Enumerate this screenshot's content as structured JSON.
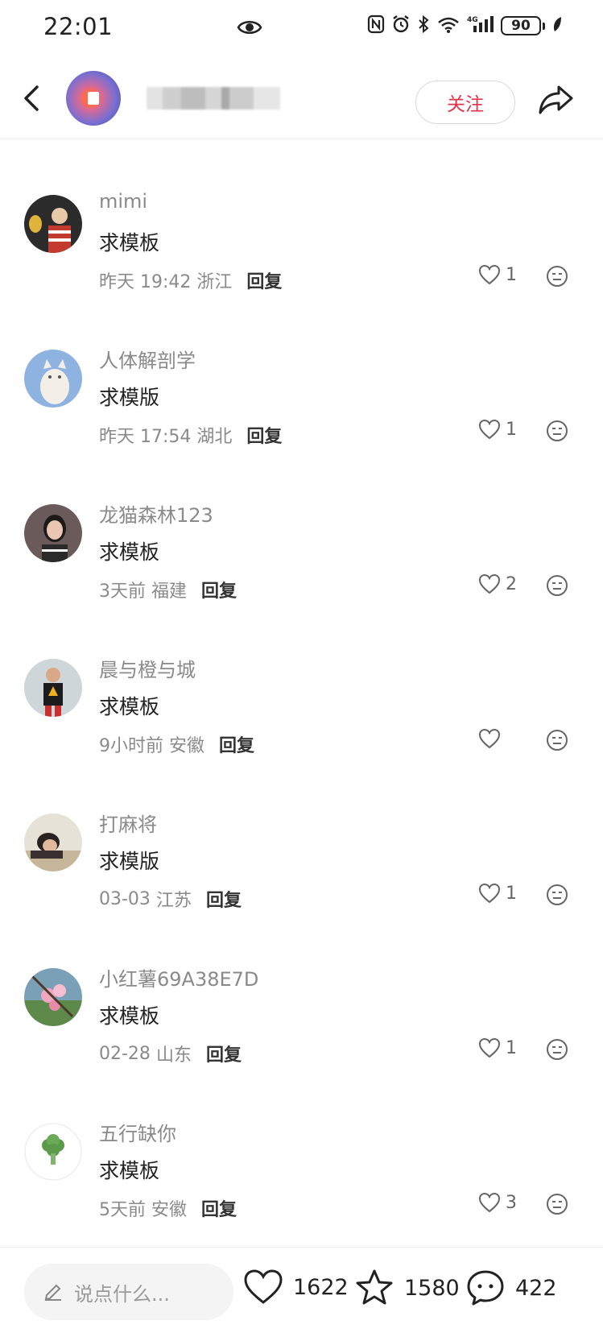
{
  "status_bar": {
    "time": "22:01",
    "battery": "90"
  },
  "header": {
    "follow_label": "关注"
  },
  "comments": [
    {
      "username": "mimi",
      "text": "求模板",
      "time": "昨天 19:42",
      "location": "浙江",
      "reply": "回复",
      "likes": "1"
    },
    {
      "username": "人体解剖学",
      "text": "求模版",
      "time": "昨天 17:54",
      "location": "湖北",
      "reply": "回复",
      "likes": "1"
    },
    {
      "username": "龙猫森林123",
      "text": "求模板",
      "time": "3天前",
      "location": "福建",
      "reply": "回复",
      "likes": "2"
    },
    {
      "username": "晨与橙与城",
      "text": "求模板",
      "time": "9小时前",
      "location": "安徽",
      "reply": "回复",
      "likes": ""
    },
    {
      "username": "打麻将",
      "text": "求模版",
      "time": "03-03",
      "location": "江苏",
      "reply": "回复",
      "likes": "1"
    },
    {
      "username": "小红薯69A38E7D",
      "text": "求模板",
      "time": "02-28",
      "location": "山东",
      "reply": "回复",
      "likes": "1"
    },
    {
      "username": "五行缺你",
      "text": "求模板",
      "time": "5天前",
      "location": "安徽",
      "reply": "回复",
      "likes": "3"
    }
  ],
  "bottom_bar": {
    "input_placeholder": "说点什么...",
    "like_count": "1622",
    "star_count": "1580",
    "comment_count": "422"
  },
  "colors": {
    "accent": "#e0344a",
    "muted_text": "#8a8a8a"
  }
}
